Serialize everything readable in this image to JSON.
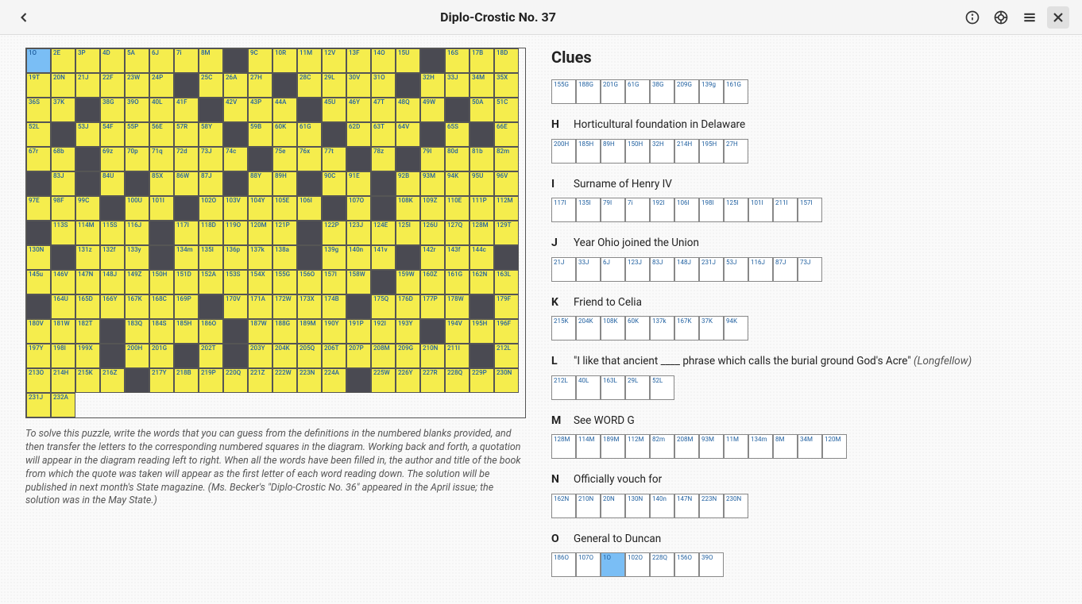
{
  "header": {
    "title": "Diplo-Crostic No. 37"
  },
  "grid": {
    "cols": 20,
    "cells": [
      [
        "1O",
        "a"
      ],
      [
        "2E",
        "f"
      ],
      [
        "3P",
        "f"
      ],
      [
        "4D",
        "f"
      ],
      [
        "5A",
        "f"
      ],
      [
        "6J",
        "f"
      ],
      [
        "7i",
        "f"
      ],
      [
        "8M",
        "f"
      ],
      [
        "",
        "b"
      ],
      [
        "9C",
        "f"
      ],
      [
        "10R",
        "f"
      ],
      [
        "11M",
        "f"
      ],
      [
        "12V",
        "f"
      ],
      [
        "13F",
        "f"
      ],
      [
        "14O",
        "f"
      ],
      [
        "15U",
        "f"
      ],
      [
        "",
        "b"
      ],
      [
        "16S",
        "f"
      ],
      [
        "17B",
        "f"
      ],
      [
        "18D",
        "f"
      ],
      [
        "19T",
        "f"
      ],
      [
        "20N",
        "f"
      ],
      [
        "21J",
        "f"
      ],
      [
        "22F",
        "f"
      ],
      [
        "23W",
        "f"
      ],
      [
        "24P",
        "f"
      ],
      [
        "",
        "b"
      ],
      [
        "25C",
        "f"
      ],
      [
        "26A",
        "f"
      ],
      [
        "27H",
        "f"
      ],
      [
        "",
        "b"
      ],
      [
        "28C",
        "f"
      ],
      [
        "29L",
        "f"
      ],
      [
        "30V",
        "f"
      ],
      [
        "31O",
        "f"
      ],
      [
        "",
        "b"
      ],
      [
        "32H",
        "f"
      ],
      [
        "33J",
        "f"
      ],
      [
        "34M",
        "f"
      ],
      [
        "35X",
        "f"
      ],
      [
        "36S",
        "f"
      ],
      [
        "37K",
        "f"
      ],
      [
        "",
        "b"
      ],
      [
        "38G",
        "f"
      ],
      [
        "39O",
        "f"
      ],
      [
        "40L",
        "f"
      ],
      [
        "41F",
        "f"
      ],
      [
        "",
        "b"
      ],
      [
        "42V",
        "f"
      ],
      [
        "43P",
        "f"
      ],
      [
        "44A",
        "f"
      ],
      [
        "",
        "b"
      ],
      [
        "45U",
        "f"
      ],
      [
        "46Y",
        "f"
      ],
      [
        "47T",
        "f"
      ],
      [
        "48Q",
        "f"
      ],
      [
        "49W",
        "f"
      ],
      [
        "",
        "b"
      ],
      [
        "50A",
        "f"
      ],
      [
        "51C",
        "f"
      ],
      [
        "52L",
        "f"
      ],
      [
        "",
        "b"
      ],
      [
        "53J",
        "f"
      ],
      [
        "54F",
        "f"
      ],
      [
        "55P",
        "f"
      ],
      [
        "56E",
        "f"
      ],
      [
        "57R",
        "f"
      ],
      [
        "58Y",
        "f"
      ],
      [
        "",
        "b"
      ],
      [
        "59B",
        "f"
      ],
      [
        "60K",
        "f"
      ],
      [
        "61G",
        "f"
      ],
      [
        "",
        "b"
      ],
      [
        "62D",
        "f"
      ],
      [
        "63T",
        "f"
      ],
      [
        "64V",
        "f"
      ],
      [
        "",
        "b"
      ],
      [
        "65S",
        "f"
      ],
      [
        "",
        "b"
      ],
      [
        "66E",
        "f"
      ],
      [
        "67r",
        "f"
      ],
      [
        "68b",
        "f"
      ],
      [
        "",
        "b"
      ],
      [
        "69z",
        "f"
      ],
      [
        "70p",
        "f"
      ],
      [
        "71q",
        "f"
      ],
      [
        "72d",
        "f"
      ],
      [
        "73J",
        "f"
      ],
      [
        "74c",
        "f"
      ],
      [
        "",
        "b"
      ],
      [
        "75e",
        "f"
      ],
      [
        "76x",
        "f"
      ],
      [
        "77t",
        "f"
      ],
      [
        "",
        "b"
      ],
      [
        "78z",
        "f"
      ],
      [
        "",
        "b"
      ],
      [
        "79I",
        "f"
      ],
      [
        "80d",
        "f"
      ],
      [
        "81b",
        "f"
      ],
      [
        "82m",
        "f"
      ],
      [
        "",
        "b"
      ],
      [
        "83J",
        "f"
      ],
      [
        "",
        "b"
      ],
      [
        "84U",
        "f"
      ],
      [
        "",
        "b"
      ],
      [
        "85X",
        "f"
      ],
      [
        "86W",
        "f"
      ],
      [
        "87J",
        "f"
      ],
      [
        "",
        "b"
      ],
      [
        "88Y",
        "f"
      ],
      [
        "89H",
        "f"
      ],
      [
        "",
        "b"
      ],
      [
        "90C",
        "f"
      ],
      [
        "91E",
        "f"
      ],
      [
        "",
        "b"
      ],
      [
        "92B",
        "f"
      ],
      [
        "93M",
        "f"
      ],
      [
        "94K",
        "f"
      ],
      [
        "95U",
        "f"
      ],
      [
        "96V",
        "f"
      ],
      [
        "97E",
        "f"
      ],
      [
        "98F",
        "f"
      ],
      [
        "99C",
        "f"
      ],
      [
        "",
        "b"
      ],
      [
        "100U",
        "f"
      ],
      [
        "101I",
        "f"
      ],
      [
        "",
        "b"
      ],
      [
        "102O",
        "f"
      ],
      [
        "103V",
        "f"
      ],
      [
        "104Y",
        "f"
      ],
      [
        "105E",
        "f"
      ],
      [
        "106I",
        "f"
      ],
      [
        "",
        "b"
      ],
      [
        "107O",
        "f"
      ],
      [
        "",
        "b"
      ],
      [
        "108K",
        "f"
      ],
      [
        "109Z",
        "f"
      ],
      [
        "110E",
        "f"
      ],
      [
        "111P",
        "f"
      ],
      [
        "112M",
        "f"
      ],
      [
        "",
        "b"
      ],
      [
        "113S",
        "f"
      ],
      [
        "114M",
        "f"
      ],
      [
        "115S",
        "f"
      ],
      [
        "116J",
        "f"
      ],
      [
        "",
        "b"
      ],
      [
        "117I",
        "f"
      ],
      [
        "118D",
        "f"
      ],
      [
        "119O",
        "f"
      ],
      [
        "120M",
        "f"
      ],
      [
        "121P",
        "f"
      ],
      [
        "",
        "b"
      ],
      [
        "122P",
        "f"
      ],
      [
        "123J",
        "f"
      ],
      [
        "124E",
        "f"
      ],
      [
        "125I",
        "f"
      ],
      [
        "126U",
        "f"
      ],
      [
        "127Q",
        "f"
      ],
      [
        "128M",
        "f"
      ],
      [
        "129T",
        "f"
      ],
      [
        "130N",
        "f"
      ],
      [
        "",
        "b"
      ],
      [
        "131z",
        "f"
      ],
      [
        "132f",
        "f"
      ],
      [
        "133y",
        "f"
      ],
      [
        "",
        "b"
      ],
      [
        "134m",
        "f"
      ],
      [
        "135I",
        "f"
      ],
      [
        "136p",
        "f"
      ],
      [
        "137k",
        "f"
      ],
      [
        "138a",
        "f"
      ],
      [
        "",
        "b"
      ],
      [
        "139g",
        "f"
      ],
      [
        "140n",
        "f"
      ],
      [
        "141v",
        "f"
      ],
      [
        "",
        "b"
      ],
      [
        "142r",
        "f"
      ],
      [
        "143f",
        "f"
      ],
      [
        "144c",
        "f"
      ],
      [
        "",
        "b"
      ],
      [
        "145u",
        "f"
      ],
      [
        "146V",
        "f"
      ],
      [
        "147N",
        "f"
      ],
      [
        "148J",
        "f"
      ],
      [
        "149Z",
        "f"
      ],
      [
        "150H",
        "f"
      ],
      [
        "151D",
        "f"
      ],
      [
        "152A",
        "f"
      ],
      [
        "153S",
        "f"
      ],
      [
        "154X",
        "f"
      ],
      [
        "155G",
        "f"
      ],
      [
        "156O",
        "f"
      ],
      [
        "157I",
        "f"
      ],
      [
        "158W",
        "f"
      ],
      [
        "",
        "b"
      ],
      [
        "159W",
        "f"
      ],
      [
        "160Z",
        "f"
      ],
      [
        "161G",
        "f"
      ],
      [
        "162N",
        "f"
      ],
      [
        "163L",
        "f"
      ],
      [
        "",
        "b"
      ],
      [
        "164U",
        "f"
      ],
      [
        "165D",
        "f"
      ],
      [
        "166Y",
        "f"
      ],
      [
        "167K",
        "f"
      ],
      [
        "168C",
        "f"
      ],
      [
        "169P",
        "f"
      ],
      [
        "",
        "b"
      ],
      [
        "170V",
        "f"
      ],
      [
        "171A",
        "f"
      ],
      [
        "172W",
        "f"
      ],
      [
        "173X",
        "f"
      ],
      [
        "174B",
        "f"
      ],
      [
        "",
        "b"
      ],
      [
        "175Q",
        "f"
      ],
      [
        "176D",
        "f"
      ],
      [
        "177P",
        "f"
      ],
      [
        "178W",
        "f"
      ],
      [
        "",
        "b"
      ],
      [
        "179F",
        "f"
      ],
      [
        "180V",
        "f"
      ],
      [
        "181W",
        "f"
      ],
      [
        "182T",
        "f"
      ],
      [
        "",
        "b"
      ],
      [
        "183Q",
        "f"
      ],
      [
        "184S",
        "f"
      ],
      [
        "185H",
        "f"
      ],
      [
        "186O",
        "f"
      ],
      [
        "",
        "b"
      ],
      [
        "187W",
        "f"
      ],
      [
        "188G",
        "f"
      ],
      [
        "189M",
        "f"
      ],
      [
        "190Y",
        "f"
      ],
      [
        "191P",
        "f"
      ],
      [
        "192I",
        "f"
      ],
      [
        "193Y",
        "f"
      ],
      [
        "",
        "b"
      ],
      [
        "194V",
        "f"
      ],
      [
        "195H",
        "f"
      ],
      [
        "196F",
        "f"
      ],
      [
        "197Y",
        "f"
      ],
      [
        "198I",
        "f"
      ],
      [
        "199X",
        "f"
      ],
      [
        "",
        "b"
      ],
      [
        "200H",
        "f"
      ],
      [
        "201G",
        "f"
      ],
      [
        "",
        "b"
      ],
      [
        "202T",
        "f"
      ],
      [
        "",
        "b"
      ],
      [
        "203Y",
        "f"
      ],
      [
        "204K",
        "f"
      ],
      [
        "205Q",
        "f"
      ],
      [
        "206T",
        "f"
      ],
      [
        "207P",
        "f"
      ],
      [
        "208M",
        "f"
      ],
      [
        "209G",
        "f"
      ],
      [
        "210N",
        "f"
      ],
      [
        "211I",
        "f"
      ],
      [
        "",
        "b"
      ],
      [
        "212L",
        "f"
      ],
      [
        "213O",
        "f"
      ],
      [
        "214H",
        "f"
      ],
      [
        "215K",
        "f"
      ],
      [
        "216Z",
        "f"
      ],
      [
        "",
        "b"
      ],
      [
        "217Y",
        "f"
      ],
      [
        "218B",
        "f"
      ],
      [
        "219P",
        "f"
      ],
      [
        "220Q",
        "f"
      ],
      [
        "221Z",
        "f"
      ],
      [
        "222W",
        "f"
      ],
      [
        "223N",
        "f"
      ],
      [
        "224A",
        "f"
      ],
      [
        "",
        "b"
      ],
      [
        "225W",
        "f"
      ],
      [
        "226Y",
        "f"
      ],
      [
        "227R",
        "f"
      ],
      [
        "228Q",
        "f"
      ],
      [
        "229P",
        "f"
      ],
      [
        "230N",
        "f"
      ],
      [
        "231J",
        "f"
      ],
      [
        "232A",
        "f"
      ]
    ]
  },
  "instructions": "To solve this puzzle, write the words that you can guess from the definitions in the numbered blanks provided, and then transfer the letters to the corresponding numbered squares in the diagram. Working back and forth, a quotation will appear in the diagram reading left to right. When all the words have been filled in, the author and title of the book from which the quote was taken will appear as the first letter of each word reading down. The solution will be published in next month's State magazine. (Ms. Becker's \"Diplo-Crostic No. 36\" appeared in the April issue; the solution was in the May State.)",
  "clues_title": "Clues",
  "clues": [
    {
      "letter": "",
      "text": "",
      "cells": [
        "155G",
        "188G",
        "201G",
        "61G",
        "38G",
        "209G",
        "139g",
        "161G"
      ]
    },
    {
      "letter": "H",
      "text": "Horticultural foundation in Delaware",
      "cells": [
        "200H",
        "185H",
        "89H",
        "150H",
        "32H",
        "214H",
        "195H",
        "27H"
      ]
    },
    {
      "letter": "I",
      "text": "Surname of Henry IV",
      "cells": [
        "117I",
        "135I",
        "79I",
        "7i",
        "192I",
        "106I",
        "198I",
        "125I",
        "101I",
        "211I",
        "157I"
      ]
    },
    {
      "letter": "J",
      "text": "Year Ohio joined the Union",
      "cells": [
        "21J",
        "33J",
        "6J",
        "123J",
        "83J",
        "148J",
        "231J",
        "53J",
        "116J",
        "87J",
        "73J"
      ]
    },
    {
      "letter": "K",
      "text": "Friend to Celia",
      "cells": [
        "215K",
        "204K",
        "108K",
        "60K",
        "137k",
        "167K",
        "37K",
        "94K"
      ]
    },
    {
      "letter": "L",
      "text": "\"I like that ancient ____ phrase which calls the burial ground God's Acre\"",
      "attrib": "(Longfellow)",
      "cells": [
        "212L",
        "40L",
        "163L",
        "29L",
        "52L"
      ]
    },
    {
      "letter": "M",
      "text": "See WORD G",
      "cells": [
        "128M",
        "114M",
        "189M",
        "112M",
        "82m",
        "208M",
        "93M",
        "11M",
        "134m",
        "8M",
        "34M",
        "120M"
      ]
    },
    {
      "letter": "N",
      "text": "Officially vouch for",
      "cells": [
        "162N",
        "210N",
        "20N",
        "130N",
        "140n",
        "147N",
        "223N",
        "230N"
      ]
    },
    {
      "letter": "O",
      "text": "General to Duncan",
      "cells": [
        "186O",
        "107O",
        "1O",
        "102O",
        "228Q",
        "156O",
        "39O"
      ],
      "active_index": 2
    }
  ]
}
